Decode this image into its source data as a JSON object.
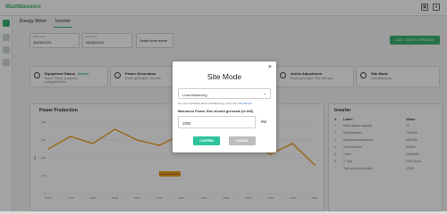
{
  "app": {
    "title": "WattMaestro"
  },
  "tabs": [
    {
      "label": "Energy Meter"
    },
    {
      "label": "Inverter"
    }
  ],
  "filters": {
    "start_label": "Start Date",
    "start_value": "05/06/2024",
    "end_label": "End Date",
    "end_value": "06/06/2024",
    "timer_placeholder": "Select time frame"
  },
  "action_button": "LAST 1 DAYS / 1 HRS AGO",
  "cards": [
    {
      "title": "Equipment Status",
      "status": "Online",
      "subtitle": "Brand: Sector, producing",
      "subtitle2": "energy/ID/active"
    },
    {
      "title": "Power Generation",
      "subtitle": "Power generated: 118 kWh"
    },
    {
      "title": "Active Adjustment",
      "subtitle": "Power generated: 99.8 kWh ago"
    },
    {
      "title": "Site Mode",
      "subtitle": "Load Balancing"
    }
  ],
  "chart_panel": {
    "title": "Power Production",
    "legend": "Power Production"
  },
  "chart_data": {
    "type": "line",
    "title": "Power Production",
    "categories": [
      "06/06",
      "07/06",
      "08/06",
      "09/06",
      "10/06",
      "11/06",
      "12/06",
      "13/06",
      "14/06",
      "15/06",
      "16/06",
      "17/06",
      "18/06"
    ],
    "series": [
      {
        "name": "Power Production",
        "values": [
          250,
          320,
          280,
          360,
          300,
          270,
          330,
          260,
          240,
          300,
          220,
          280,
          160
        ]
      }
    ],
    "ylim": [
      0,
      400
    ],
    "yticks": [
      "400",
      "300",
      "200",
      "100",
      "0"
    ],
    "ylabel": "kW",
    "color": "#f0a020"
  },
  "inverter": {
    "title": "Inverter",
    "col_num": "#",
    "col_label": "Label",
    "col_value": "Value",
    "rows": [
      {
        "n": "1",
        "label": "Rated power capacity",
        "value": "20"
      },
      {
        "n": "2",
        "label": "Serial Number",
        "value": "7974656"
      },
      {
        "n": "3",
        "label": "Adjustment equipment",
        "value": "8807028"
      },
      {
        "n": "4",
        "label": "Serial Number",
        "value": "AM543"
      },
      {
        "n": "5",
        "label": "Cable",
        "value": "SolarMAN"
      },
      {
        "n": "6",
        "label": "Z-Type",
        "value": "2024-06-06"
      },
      {
        "n": "7",
        "label": "Total active production",
        "value": "27349"
      }
    ]
  },
  "modal": {
    "title": "Site Mode",
    "close_symbol": "×",
    "mode_value": "Load Balancing",
    "info_text": "For more information about Load Balancing, refer to the",
    "info_link": "User Manual",
    "question": "Maximum Power Site should generate (in kW)",
    "power_value": "1000",
    "unit": "kW",
    "confirm_label": "CONFIRM",
    "cancel_label": "CANCEL"
  }
}
